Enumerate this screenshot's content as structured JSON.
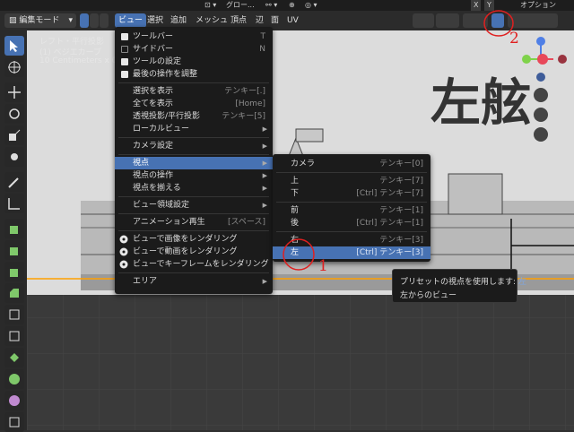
{
  "topbar": {
    "global_label": "グロー...",
    "x_label": "X",
    "y_label": "Y",
    "options_label": "オプション"
  },
  "header": {
    "mode_label": "編集モード",
    "menus": [
      "ビュー",
      "選択",
      "追加",
      "メッシュ",
      "頂点",
      "辺",
      "面",
      "UV"
    ]
  },
  "viewport": {
    "overlay_line1": "レフト・平行投影",
    "overlay_line2": "(1) ベジエカーブ",
    "overlay_line3": "10 Centimeters x 0.01",
    "bg_text": "左舷"
  },
  "view_menu": [
    {
      "type": "check",
      "checked": true,
      "label": "ツールバー",
      "shortcut": "T"
    },
    {
      "type": "check",
      "checked": false,
      "label": "サイドバー",
      "shortcut": "N"
    },
    {
      "type": "check",
      "checked": true,
      "label": "ツールの設定",
      "shortcut": ""
    },
    {
      "type": "check",
      "checked": true,
      "label": "最後の操作を調整",
      "shortcut": ""
    },
    {
      "type": "sep"
    },
    {
      "type": "item",
      "label": "選択を表示",
      "shortcut": "テンキー[.]"
    },
    {
      "type": "item",
      "label": "全てを表示",
      "shortcut": "[Home]"
    },
    {
      "type": "item",
      "label": "透視投影/平行投影",
      "shortcut": "テンキー[5]"
    },
    {
      "type": "sub",
      "label": "ローカルビュー",
      "shortcut": ""
    },
    {
      "type": "sep"
    },
    {
      "type": "sub",
      "label": "カメラ設定",
      "shortcut": ""
    },
    {
      "type": "sep"
    },
    {
      "type": "sub",
      "label": "視点",
      "shortcut": "",
      "highlight": true
    },
    {
      "type": "sub",
      "label": "視点の操作",
      "shortcut": ""
    },
    {
      "type": "sub",
      "label": "視点を揃える",
      "shortcut": ""
    },
    {
      "type": "sep"
    },
    {
      "type": "sub",
      "label": "ビュー領域設定",
      "shortcut": ""
    },
    {
      "type": "sep"
    },
    {
      "type": "item",
      "label": "アニメーション再生",
      "shortcut": "[スペース]"
    },
    {
      "type": "sep"
    },
    {
      "type": "icon",
      "icon": "render-image-icon",
      "label": "ビューで画像をレンダリング",
      "shortcut": ""
    },
    {
      "type": "icon",
      "icon": "render-animation-icon",
      "label": "ビューで動画をレンダリング",
      "shortcut": ""
    },
    {
      "type": "icon",
      "icon": "render-keyframe-icon",
      "label": "ビューでキーフレームをレンダリング",
      "shortcut": ""
    },
    {
      "type": "sep"
    },
    {
      "type": "sub",
      "label": "エリア",
      "shortcut": ""
    }
  ],
  "viewpoint_menu": [
    {
      "type": "item",
      "label": "カメラ",
      "shortcut": "テンキー[0]"
    },
    {
      "type": "sep"
    },
    {
      "type": "item",
      "label": "上",
      "shortcut": "テンキー[7]"
    },
    {
      "type": "item",
      "label": "下",
      "shortcut": "[Ctrl] テンキー[7]"
    },
    {
      "type": "sep"
    },
    {
      "type": "item",
      "label": "前",
      "shortcut": "テンキー[1]"
    },
    {
      "type": "item",
      "label": "後",
      "shortcut": "[Ctrl] テンキー[1]"
    },
    {
      "type": "sep"
    },
    {
      "type": "item",
      "label": "右",
      "shortcut": "テンキー[3]"
    },
    {
      "type": "item",
      "label": "左",
      "shortcut": "[Ctrl] テンキー[3]",
      "highlight": true
    }
  ],
  "tooltip": {
    "line1_prefix": "プリセットの視点を使用します: ",
    "line1_value": "左",
    "line2": "左からのビュー"
  },
  "annotations": {
    "label1": "1",
    "label2": "2",
    "color": "#e02020"
  },
  "colors": {
    "accent": "#4772b3",
    "menu_bg": "#1b1b1b",
    "viewport_bg": "#3a3a3a"
  }
}
